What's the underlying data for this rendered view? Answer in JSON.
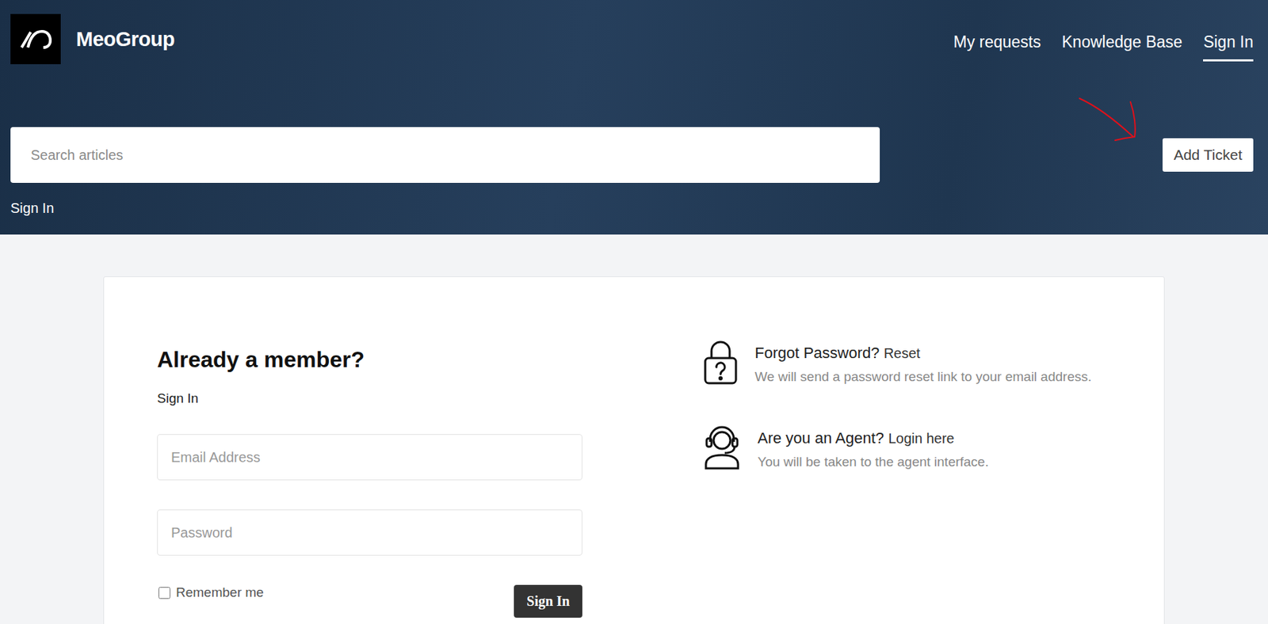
{
  "header": {
    "brand": "MeoGroup",
    "nav": [
      {
        "label": "My requests",
        "selected": false
      },
      {
        "label": "Knowledge Base",
        "selected": false
      },
      {
        "label": "Sign In",
        "selected": true
      }
    ],
    "search": {
      "placeholder": "Search articles"
    },
    "add_ticket": "Add Ticket",
    "breadcrumb": "Sign In"
  },
  "login": {
    "title": "Already a member?",
    "subtitle": "Sign In",
    "email_placeholder": "Email Address",
    "password_placeholder": "Password",
    "remember": {
      "label": "Remember me",
      "checked": false
    },
    "button": "Sign In"
  },
  "help": [
    {
      "kind": "lock",
      "title": "Forgot Password?",
      "link": "Reset",
      "text": "We will send a password reset link to your email address."
    },
    {
      "kind": "agent",
      "title": "Are you an Agent?",
      "link": "Login here",
      "text": "You will be taken to the agent interface."
    }
  ]
}
